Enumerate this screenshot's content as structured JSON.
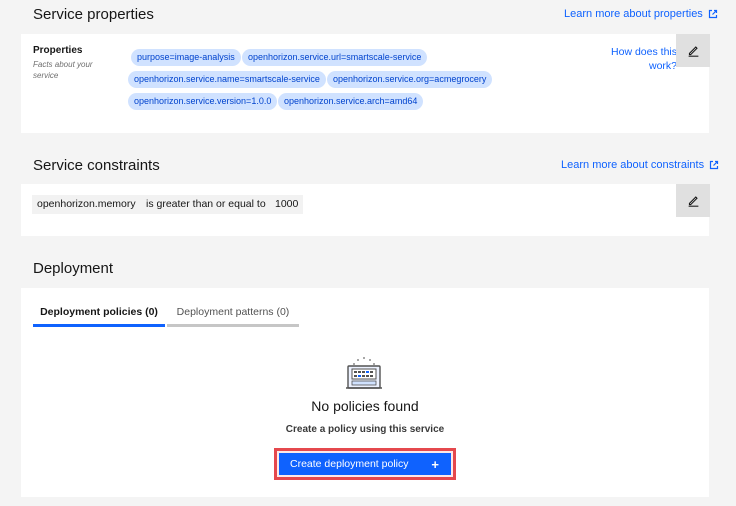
{
  "properties_section": {
    "title": "Service properties",
    "learn_more": "Learn more about properties",
    "card_label": "Properties",
    "card_sublabel": "Facts about your service",
    "help_link": "How does this work?",
    "tags": [
      "purpose=image-analysis",
      "openhorizon.service.url=smartscale-service",
      "openhorizon.service.name=smartscale-service",
      "openhorizon.service.org=acmegrocery",
      "openhorizon.service.version=1.0.0",
      "openhorizon.service.arch=amd64"
    ]
  },
  "constraints_section": {
    "title": "Service constraints",
    "learn_more": "Learn more about constraints",
    "constraint": {
      "property": "openhorizon.memory",
      "operator": "is greater than or equal to",
      "value": "1000"
    }
  },
  "deployment_section": {
    "title": "Deployment",
    "tabs": [
      "Deployment policies (0)",
      "Deployment patterns (0)"
    ],
    "active_tab": 0,
    "empty_title": "No policies found",
    "empty_subtitle": "Create a policy using this service",
    "create_button": "Create deployment policy",
    "create_button_icon": "+"
  },
  "colors": {
    "accent": "#0f62fe",
    "tag_bg": "#d0e2ff",
    "highlight": "#e5484d"
  },
  "icons": {
    "edit": "pencil-icon",
    "external": "launch-icon",
    "empty_state": "server-icon"
  }
}
